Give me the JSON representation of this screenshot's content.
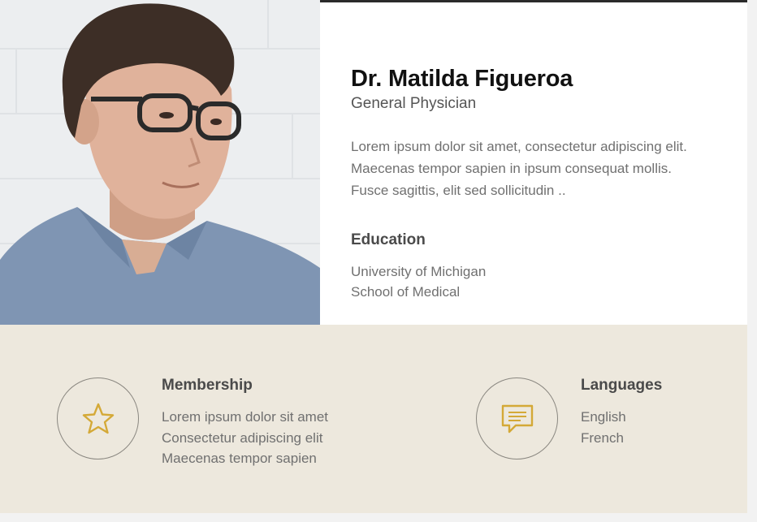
{
  "profile": {
    "name": "Dr. Matilda Figueroa",
    "role": "General Physician",
    "bio": "Lorem ipsum dolor sit amet, consectetur adipiscing elit. Maecenas tempor sapien in ipsum consequat mollis. Fusce sagittis, elit sed sollicitudin ..",
    "photo_icon": "person-portrait"
  },
  "education": {
    "title": "Education",
    "lines": [
      "University of Michigan",
      "School of Medical"
    ]
  },
  "membership": {
    "title": "Membership",
    "icon": "star-icon",
    "lines": [
      "Lorem ipsum dolor sit amet",
      "Consectetur adipiscing elit",
      "Maecenas tempor sapien"
    ]
  },
  "languages": {
    "title": "Languages",
    "icon": "chat-icon",
    "lines": [
      "English",
      "French"
    ]
  },
  "colors": {
    "accent": "#d4a937",
    "band": "#ede8dd",
    "circle_border": "#8a8780"
  }
}
